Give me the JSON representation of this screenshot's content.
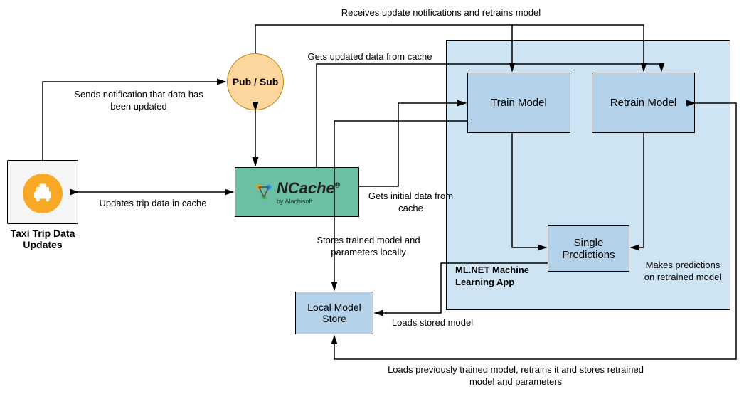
{
  "nodes": {
    "taxi_caption": "Taxi Trip Data Updates",
    "pubsub": "Pub / Sub",
    "ncache": "NCache",
    "ncache_by": "by Alachisoft",
    "mlapp": "ML.NET Machine Learning App",
    "train": "Train Model",
    "retrain": "Retrain Model",
    "single": "Single Predictions",
    "localstore": "Local Model Store"
  },
  "edges": {
    "updates_trip": "Updates trip data in cache",
    "sends_notif": "Sends notification that data has been updated",
    "receives_update": "Receives update notifications and retrains model",
    "gets_updated": "Gets updated data from cache",
    "gets_initial": "Gets initial data from cache",
    "stores_trained": "Stores trained model and parameters locally",
    "loads_stored": "Loads stored model",
    "makes_pred": "Makes predictions on retrained model",
    "loads_prev": "Loads previously trained model, retrains it and stores retrained model and parameters"
  }
}
